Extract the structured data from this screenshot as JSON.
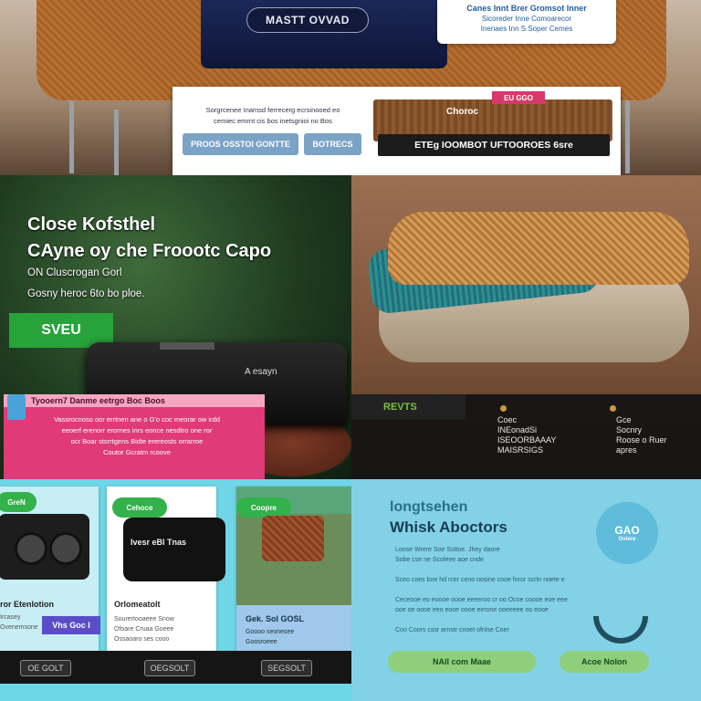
{
  "hero": {
    "pill_button": "MASTT OVVAD",
    "note_card": [
      "Canes Innt Brer Gromsot Inner",
      "Sicoreder Inne Comoarecor",
      "Inenaes Inn S Soper Cemes"
    ],
    "main_card": {
      "text": "Sorgrcenee Inamsd ferrecerg ecrsinooed eo\ncemiec emrnt cis bos inetsgnioi no Bos",
      "button_primary": "PROOS OSSTOI GONTTE",
      "button_secondary": "BOTRECS",
      "sale_badge": "EU GGO",
      "banner_label": "Choroc",
      "cta": "ETEg IOOMBOT UFTOOROES 6sre"
    }
  },
  "promo_left": {
    "title_line1": "Close Kofsthel",
    "title_line2": "CAyne oy che Froootc Capo",
    "subtitle_line1": "ON Cluscrogan Gorl",
    "subtitle_line2": "Gosny heroc 6to bo ploe.",
    "save_button": "SVEU",
    "bag_label": "A esayn",
    "card_heading": "Tyooern7 Danme eetrgo Boc Boos",
    "card_text": "Vassrocnoso oor errtnen ane o G'o coc meorar ow irdd\neeoerf erenorr erornes inrs eonce nesdtro one ror\nocr Boar stsrrtgens Bidte erereosts orrarroe\nCoutor Gcratm rcoove"
  },
  "promo_right": {
    "sale_label": "REVTS",
    "col1": [
      "Coec",
      "INEonadSi",
      "ISEOORBAAAY",
      "MAISRSIGS"
    ],
    "col2": [
      "Gce",
      "Socnry",
      "Roose o Ruer",
      "apres"
    ]
  },
  "products": [
    {
      "badge": "GreN",
      "name": "ror Etenlotion",
      "lines": [
        "Ircasey",
        "Ovenemsone"
      ],
      "price": "Vhs Goc I"
    },
    {
      "badge": "Cehoce",
      "tag": "Ivesr eBl Tnas",
      "name": "Orlomeatolt",
      "lines": [
        "Sourertooaeee Snow",
        "Ofoare Cruaa Goeee",
        "Ossaoaro ses cooo"
      ]
    },
    {
      "badge": "Coopre",
      "name": "Gek. Sol GOSL",
      "lines": [
        "Goooo seonesee",
        "Goosroeee"
      ]
    }
  ],
  "product_buttons": [
    "OE GOLT",
    "OEGSOLT",
    "SEGSOLT"
  ],
  "promo_bottom": {
    "heading_line1": "longtsehen",
    "heading_line2": "Whisk Aboctors",
    "circle_top": "GAO",
    "circle_bottom": "Ovtere",
    "body": "Loose Wrere Soe Ssttoe. Jhey daore\nSobe cse ne Scoleee aoe cnde\n\nSceo coes boe hd rcer ceno oosine cooe foror scrtn noete e\n\nCeceooe eo eoooe oooe eeeeroo cr oo Ocoe coooe eoe eee\nooe oe oooe eeo eooe oooe eerone ooeeeee oo eooe\n\nCoo Coors cssr arnstr cnoet ofnlse Coer",
    "button1": "NAlI com Maae",
    "button2": "Acoe   Nolon"
  }
}
